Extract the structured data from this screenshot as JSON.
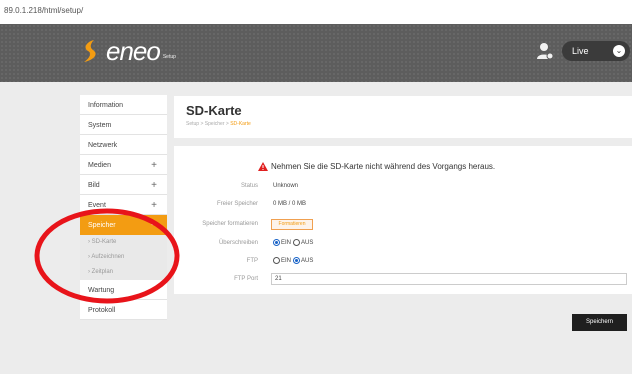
{
  "browser": {
    "url": "89.0.1.218/html/setup/"
  },
  "header": {
    "brand": "eneo",
    "brand_sub": "Setup",
    "live_label": "Live",
    "icons": [
      "user-settings-icon",
      "chevron-down-icon"
    ]
  },
  "sidebar": {
    "items": [
      {
        "label": "Information",
        "plus": ""
      },
      {
        "label": "System",
        "plus": ""
      },
      {
        "label": "Netzwerk",
        "plus": ""
      },
      {
        "label": "Medien",
        "plus": "+"
      },
      {
        "label": "Bild",
        "plus": "+"
      },
      {
        "label": "Event",
        "plus": "+"
      },
      {
        "label": "Speicher",
        "plus": "−"
      }
    ],
    "sub_items": [
      "› SD-Karte",
      "› Aufzeichnen",
      "› Zeitplan"
    ],
    "after": [
      "Wartung",
      "Protokoll"
    ]
  },
  "main": {
    "title": "SD-Karte",
    "breadcrumb_prefix": "Setup > Speicher > ",
    "breadcrumb_current": "SD-Karte",
    "warning": "Nehmen Sie die SD-Karte nicht während des Vorgangs heraus.",
    "rows": {
      "status_label": "Status",
      "status_value": "Unknown",
      "free_label": "Freier Speicher",
      "free_value": "0 MB / 0 MB",
      "format_label": "Speicher formatieren",
      "format_button": "Formatieren",
      "overwrite_label": "Überschreiben",
      "overwrite_on": "EIN",
      "overwrite_off": "AUS",
      "ftp_label": "FTP",
      "ftp_on": "EIN",
      "ftp_off": "AUS",
      "ftp_port_label": "FTP Port",
      "ftp_port_value": "21"
    },
    "overwrite_selected": "EIN",
    "ftp_selected": "AUS",
    "save_button": "Speichern"
  },
  "colors": {
    "accent": "#f39c12",
    "header_bg": "#5d5d5d",
    "annotation": "#e8141a"
  }
}
